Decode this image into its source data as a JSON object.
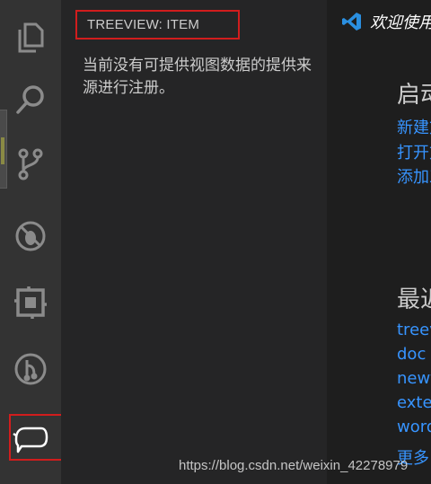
{
  "sidebar": {
    "title": "TREEVIEW: ITEM",
    "message": "当前没有可提供视图数据的提供来源进行注册。"
  },
  "activity_bar": {
    "items": [
      "explorer-icon",
      "search-icon",
      "source-control-icon",
      "debug-icon",
      "extensions-icon",
      "git-graph-icon",
      "custom-view-icon"
    ]
  },
  "editor": {
    "tab_label": "欢迎使用",
    "start_heading": "启动",
    "start_links": [
      "新建文件",
      "打开文件夹",
      "添加工作区文件夹"
    ],
    "recent_heading": "最近",
    "recent_items": [
      "treeview",
      "doc",
      "newt",
      "extension",
      "word"
    ],
    "more_label": "更多"
  },
  "watermark": "https://blog.csdn.net/weixin_42278979",
  "colors": {
    "accent_link": "#3794ff",
    "highlight_border": "#d11d1d",
    "activity_bar_bg": "#333333",
    "sidebar_bg": "#252526",
    "editor_bg": "#1e1e1e"
  }
}
